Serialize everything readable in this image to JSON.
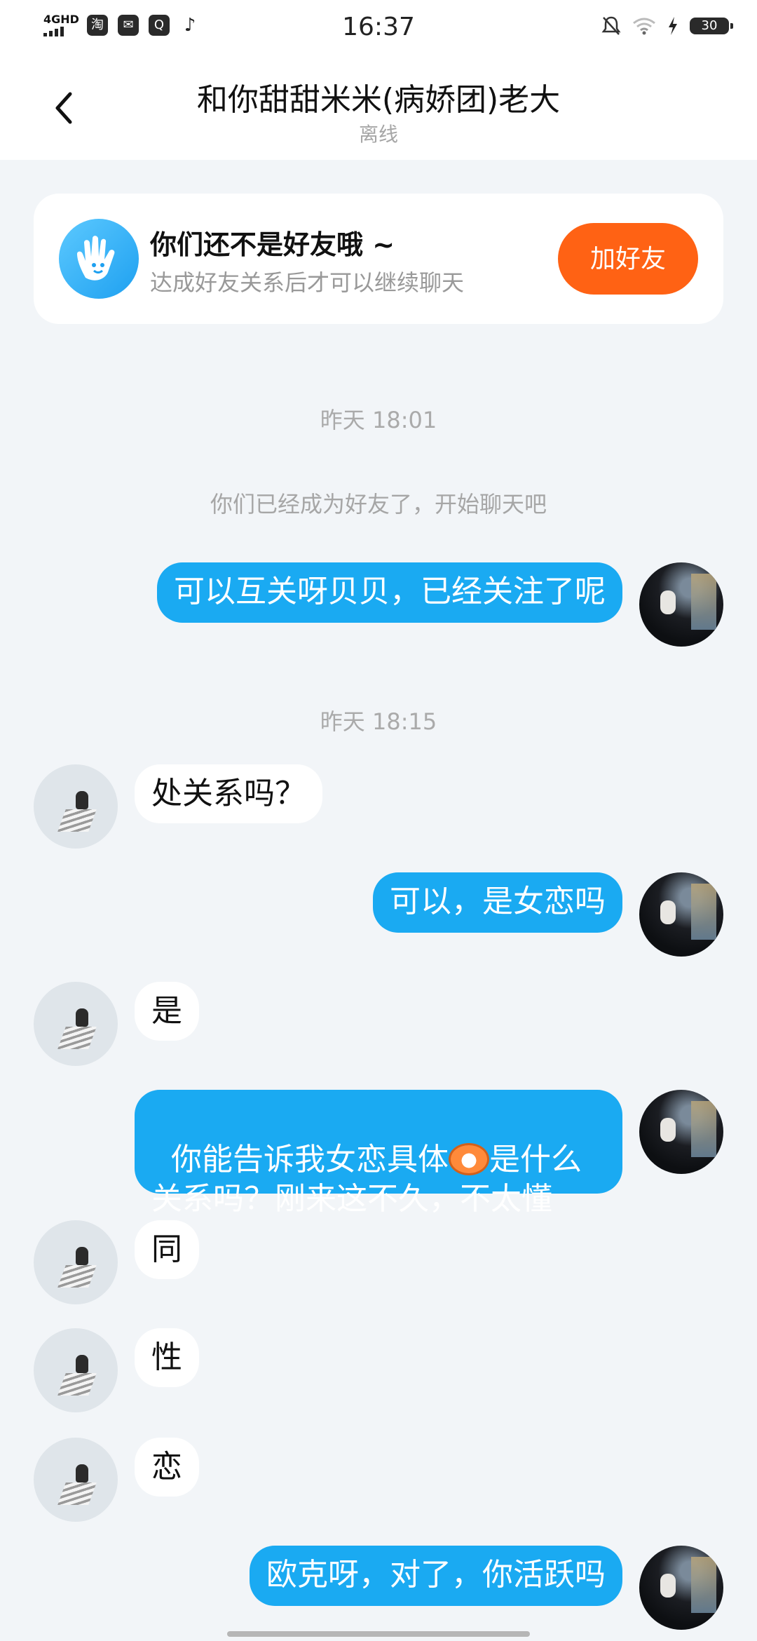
{
  "status_bar": {
    "network": "4GHD",
    "apps": [
      "淘",
      "✉",
      "Q",
      "♪"
    ],
    "time": "16:37",
    "battery": "30"
  },
  "header": {
    "title": "和你甜甜米米(病娇团)老大",
    "status": "离线"
  },
  "friend_banner": {
    "title": "你们还不是好友哦 ~",
    "subtitle": "达成好友关系后才可以继续聊天",
    "button": "加好友"
  },
  "timestamps": [
    "昨天 18:01",
    "昨天 18:15"
  ],
  "system_note": "你们已经成为好友了，开始聊天吧",
  "messages": [
    {
      "from": "me",
      "text": "可以互关呀贝贝，已经关注了呢"
    },
    {
      "from": "other",
      "text": "处关系吗？"
    },
    {
      "from": "me",
      "text": "可以，是女恋吗"
    },
    {
      "from": "other",
      "text": "是"
    },
    {
      "from": "me",
      "text_before_emoji": "你能告诉我女恋具体",
      "text_after_emoji": "是什么",
      "text_line2": "关系吗？刚来这不久，不太懂"
    },
    {
      "from": "other",
      "text": "同"
    },
    {
      "from": "other",
      "text": "性"
    },
    {
      "from": "other",
      "text": "恋"
    },
    {
      "from": "me",
      "text": "欧克呀，对了，你活跃吗"
    }
  ],
  "colors": {
    "my_bubble": "#1aaaf2",
    "add_friend_button": "#ff6214",
    "background": "#f2f5f8"
  }
}
